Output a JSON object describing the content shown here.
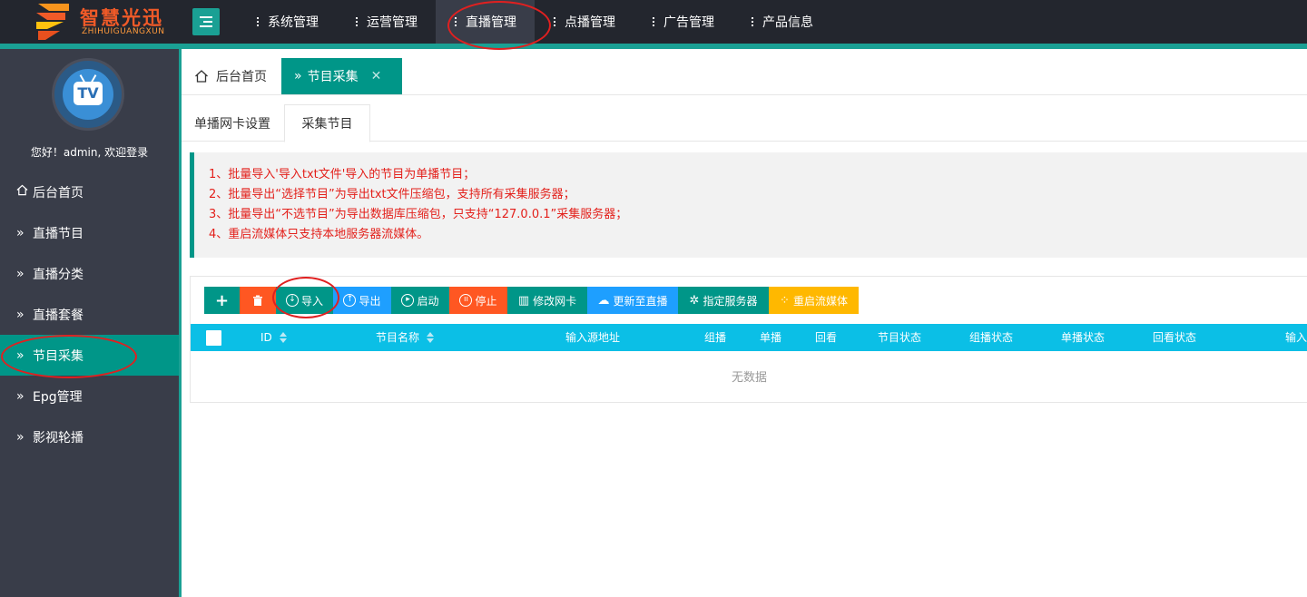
{
  "brand": {
    "name": "智慧光迅",
    "sub": "ZHIHUIGUANGXUN",
    "accent": "#009688",
    "logo_color": "#f05a28"
  },
  "topnav": {
    "items": [
      {
        "label": "系统管理",
        "active": false
      },
      {
        "label": "运营管理",
        "active": false
      },
      {
        "label": "直播管理",
        "active": true
      },
      {
        "label": "点播管理",
        "active": false
      },
      {
        "label": "广告管理",
        "active": false
      },
      {
        "label": "产品信息",
        "active": false
      }
    ]
  },
  "sidebar": {
    "welcome": "您好！admin, 欢迎登录",
    "items": [
      {
        "label": "后台首页",
        "icon": "home-icon"
      },
      {
        "label": "直播节目",
        "icon": "double-chevron-icon"
      },
      {
        "label": "直播分类",
        "icon": "double-chevron-icon"
      },
      {
        "label": "直播套餐",
        "icon": "double-chevron-icon"
      },
      {
        "label": "节目采集",
        "icon": "double-chevron-icon",
        "active": true
      },
      {
        "label": "Epg管理",
        "icon": "double-chevron-icon"
      },
      {
        "label": "影视轮播",
        "icon": "double-chevron-icon"
      }
    ]
  },
  "tabs": {
    "home": "后台首页",
    "active": "节目采集"
  },
  "subtabs": {
    "first": "单播网卡设置",
    "second": "采集节目"
  },
  "notice": {
    "lines": [
      "1、批量导入'导入txt文件'导入的节目为单播节目；",
      "2、批量导出“选择节目”为导出txt文件压缩包，支持所有采集服务器；",
      "3、批量导出“不选节目”为导出数据库压缩包，只支持“127.0.0.1”采集服务器；",
      "4、重启流媒体只支持本地服务器流媒体。"
    ]
  },
  "toolbar": {
    "add": "+",
    "import": "导入",
    "export": "导出",
    "start": "启动",
    "stop": "停止",
    "modify_nic": "修改网卡",
    "update_live": "更新至直播",
    "assign_server": "指定服务器",
    "restart_media": "重启流媒体"
  },
  "table": {
    "columns": {
      "id": "ID",
      "name": "节目名称",
      "source": "输入源地址",
      "multicast": "组播",
      "unicast": "单播",
      "playback": "回看",
      "status": "节目状态",
      "multicast_status": "组播状态",
      "unicast_status": "单播状态",
      "playback_status": "回看状态",
      "input": "输入"
    },
    "empty": "无数据"
  }
}
